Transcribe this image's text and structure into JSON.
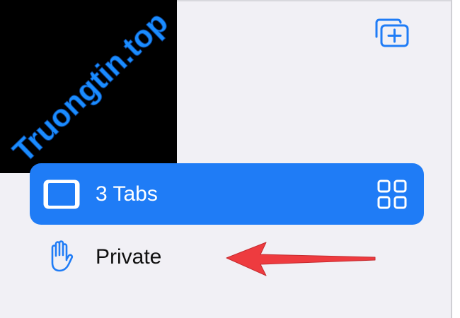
{
  "watermark": {
    "text": "Truongtin.top"
  },
  "toolbar": {
    "new_group_icon": "new-tab-group-icon"
  },
  "tab_groups": [
    {
      "label": "3 Tabs",
      "icon": "tabs-device-icon",
      "selected": true,
      "trailing_icon": "grid-icon"
    },
    {
      "label": "Private",
      "icon": "hand-icon",
      "selected": false
    }
  ],
  "colors": {
    "accent": "#1f7cf6",
    "background": "#f1f0f5",
    "arrow": "#ee3b3f",
    "watermark_text": "#1a8cff"
  }
}
